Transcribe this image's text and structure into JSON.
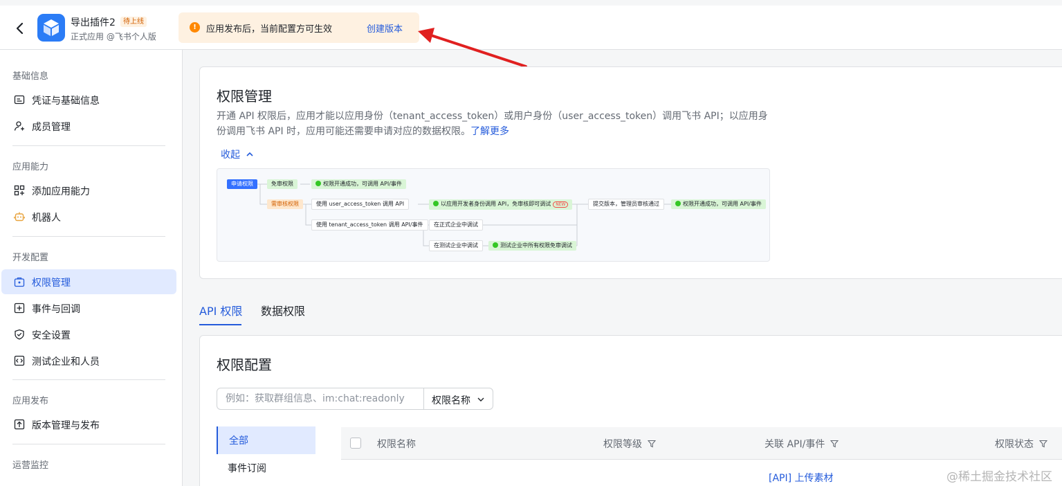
{
  "header": {
    "app_name": "导出插件2",
    "app_badge": "待上线",
    "app_subtitle": "正式应用 @飞书个人版",
    "notice_text": "应用发布后，当前配置方可生效",
    "notice_link": "创建版本",
    "notice_icon": "!"
  },
  "sidebar": {
    "groups": [
      "基础信息",
      "应用能力",
      "开发配置",
      "应用发布",
      "运营监控"
    ],
    "items": [
      {
        "label": "凭证与基础信息",
        "icon": "credential-icon"
      },
      {
        "label": "成员管理",
        "icon": "member-add-icon"
      },
      {
        "label": "添加应用能力",
        "icon": "apps-grid-icon"
      },
      {
        "label": "机器人",
        "icon": "robot-icon"
      },
      {
        "label": "权限管理",
        "icon": "permission-icon"
      },
      {
        "label": "事件与回调",
        "icon": "event-icon"
      },
      {
        "label": "安全设置",
        "icon": "shield-icon"
      },
      {
        "label": "测试企业和人员",
        "icon": "code-icon"
      },
      {
        "label": "版本管理与发布",
        "icon": "upload-icon"
      }
    ]
  },
  "permission": {
    "title": "权限管理",
    "desc": "开通 API 权限后，应用才能以应用身份（tenant_access_token）或用户身份（user_access_token）调用飞书 API；以应用身份调用飞书 API 时，应用可能还需要申请对应的数据权限。",
    "learn_more": "了解更多",
    "collapse": "收起"
  },
  "flow": {
    "apply": "申请权限",
    "free": "免审权限",
    "success": "权限开通成功，可调用 API/事件",
    "needs_review": "需审核权限",
    "user_token": "使用 user_access_token 调用 API",
    "dev_identity": "以应用开发者身份调用 API，免审核即可调试",
    "new": "NEW",
    "submit": "提交版本，管理员审核通过",
    "success2": "权限开通成功，可调用 API/事件",
    "tenant_token": "使用 tenant_access_token 调用 API/事件",
    "formal": "在正式企业中调试",
    "test": "在测试企业中调试",
    "test_free": "测试企业中所有权限免审调试"
  },
  "tabs": [
    "API 权限",
    "数据权限"
  ],
  "config": {
    "title": "权限配置",
    "search_placeholder": "例如：获取群组信息、im:chat:readonly",
    "select_value": "权限名称",
    "categories": [
      "全部",
      "事件订阅"
    ],
    "columns": [
      "权限名称",
      "权限等级",
      "关联 API/事件",
      "权限状态"
    ],
    "first_row_api": "[API] 上传素材"
  },
  "watermark": "@稀土掘金技术社区",
  "colors": {
    "accent": "#245bdb",
    "warning": "#ff8800",
    "notice_bg": "#fef1e1",
    "active_bg": "#e1eaff"
  }
}
